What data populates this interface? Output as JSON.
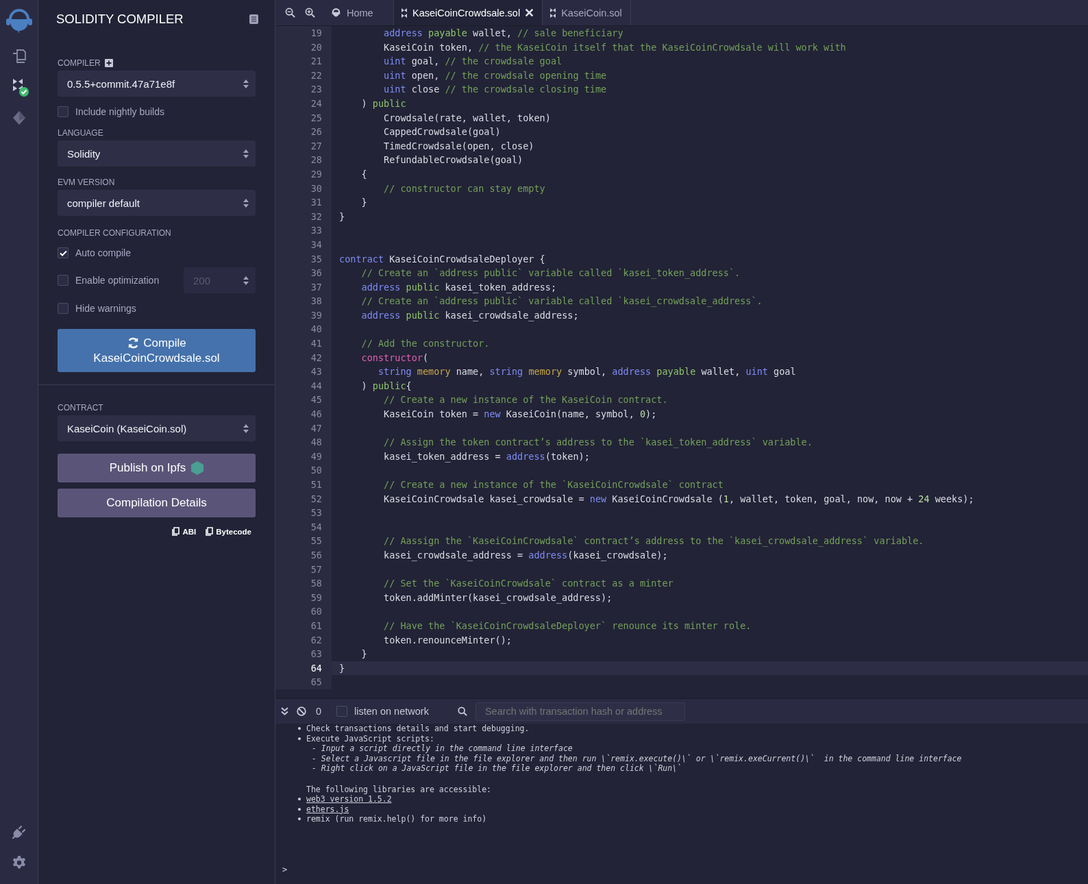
{
  "icon_bar": {
    "items": [
      {
        "kind": "logo"
      },
      {
        "kind": "files"
      },
      {
        "kind": "compiler"
      },
      {
        "kind": "deploy"
      }
    ],
    "bottom_items": [
      {
        "kind": "plugin"
      },
      {
        "kind": "settings"
      }
    ]
  },
  "panel": {
    "title": "SOLIDITY COMPILER",
    "compiler": {
      "label": "COMPILER",
      "value": "0.5.5+commit.47a71e8f"
    },
    "nightly": {
      "label": "Include nightly builds",
      "checked": false
    },
    "language": {
      "label": "LANGUAGE",
      "value": "Solidity"
    },
    "evm": {
      "label": "EVM VERSION",
      "value": "compiler default"
    },
    "config": {
      "label": "COMPILER CONFIGURATION",
      "options": [
        {
          "label": "Auto compile",
          "checked": true
        },
        {
          "label": "Enable optimization",
          "checked": false,
          "runs": "200",
          "disabled": true
        },
        {
          "label": "Hide warnings",
          "checked": false
        }
      ]
    },
    "compile_button": {
      "label": "Compile",
      "file": "KaseiCoinCrowdsale.sol"
    },
    "contract": {
      "label": "CONTRACT",
      "value": "KaseiCoin (KaseiCoin.sol)"
    },
    "buttons": [
      {
        "kind": "ipfs",
        "label": "Publish on Ipfs"
      },
      {
        "kind": "details",
        "label": "Compilation Details"
      }
    ],
    "copy_links": [
      "ABI",
      "Bytecode"
    ]
  },
  "tabs": [
    {
      "kind": "home",
      "label": "Home",
      "selected": false
    },
    {
      "kind": "file",
      "label": "KaseiCoinCrowdsale.sol",
      "selected": true
    },
    {
      "kind": "file",
      "label": "KaseiCoin.sol",
      "selected": false
    }
  ],
  "editor": {
    "lines": [
      {
        "n": "19",
        "current": false,
        "tokens": [
          {
            "kind": "type",
            "text": "        address "
          },
          {
            "kind": "modifier",
            "text": "payable"
          },
          {
            "kind": "plain",
            "text": " wallet, "
          },
          {
            "kind": "comment",
            "text": "// sale beneficiary"
          }
        ]
      },
      {
        "n": "20",
        "current": false,
        "tokens": [
          {
            "kind": "plain",
            "text": "        KaseiCoin token, "
          },
          {
            "kind": "comment",
            "text": "// the KaseiCoin itself that the KaseiCoinCrowdsale will work with"
          }
        ]
      },
      {
        "n": "21",
        "current": false,
        "tokens": [
          {
            "kind": "type",
            "text": "        uint"
          },
          {
            "kind": "plain",
            "text": " goal, "
          },
          {
            "kind": "comment",
            "text": "// the crowdsale goal"
          }
        ]
      },
      {
        "n": "22",
        "current": false,
        "tokens": [
          {
            "kind": "type",
            "text": "        uint"
          },
          {
            "kind": "plain",
            "text": " open, "
          },
          {
            "kind": "comment",
            "text": "// the crowdsale opening time"
          }
        ]
      },
      {
        "n": "23",
        "current": false,
        "tokens": [
          {
            "kind": "type",
            "text": "        uint"
          },
          {
            "kind": "plain",
            "text": " close "
          },
          {
            "kind": "comment",
            "text": "// the crowdsale closing time"
          }
        ]
      },
      {
        "n": "24",
        "current": false,
        "tokens": [
          {
            "kind": "plain",
            "text": "    ) "
          },
          {
            "kind": "modifier",
            "text": "public"
          }
        ]
      },
      {
        "n": "25",
        "current": false,
        "tokens": [
          {
            "kind": "plain",
            "text": "        Crowdsale(rate, wallet, token)"
          }
        ]
      },
      {
        "n": "26",
        "current": false,
        "tokens": [
          {
            "kind": "plain",
            "text": "        CappedCrowdsale(goal)"
          }
        ]
      },
      {
        "n": "27",
        "current": false,
        "tokens": [
          {
            "kind": "plain",
            "text": "        TimedCrowdsale(open, close)"
          }
        ]
      },
      {
        "n": "28",
        "current": false,
        "tokens": [
          {
            "kind": "plain",
            "text": "        RefundableCrowdsale(goal)"
          }
        ]
      },
      {
        "n": "29",
        "current": false,
        "tokens": [
          {
            "kind": "plain",
            "text": "    {"
          }
        ]
      },
      {
        "n": "30",
        "current": false,
        "tokens": [
          {
            "kind": "comment",
            "text": "        // constructor can stay empty"
          }
        ]
      },
      {
        "n": "31",
        "current": false,
        "tokens": [
          {
            "kind": "plain",
            "text": "    }"
          }
        ]
      },
      {
        "n": "32",
        "current": false,
        "tokens": [
          {
            "kind": "plain",
            "text": "}"
          }
        ]
      },
      {
        "n": "33",
        "current": false
      },
      {
        "n": "34",
        "current": false
      },
      {
        "n": "35",
        "current": false,
        "tokens": [
          {
            "kind": "type",
            "text": "contract"
          },
          {
            "kind": "plain",
            "text": " KaseiCoinCrowdsaleDeployer {"
          }
        ]
      },
      {
        "n": "36",
        "current": false,
        "tokens": [
          {
            "kind": "comment",
            "text": "    // Create an `address public` variable called `kasei_token_address`."
          }
        ]
      },
      {
        "n": "37",
        "current": false,
        "tokens": [
          {
            "kind": "type",
            "text": "    address "
          },
          {
            "kind": "modifier",
            "text": "public"
          },
          {
            "kind": "plain",
            "text": " kasei_token_address;"
          }
        ]
      },
      {
        "n": "38",
        "current": false,
        "tokens": [
          {
            "kind": "comment",
            "text": "    // Create an `address public` variable called `kasei_crowdsale_address`."
          }
        ]
      },
      {
        "n": "39",
        "current": false,
        "tokens": [
          {
            "kind": "type",
            "text": "    address "
          },
          {
            "kind": "modifier",
            "text": "public"
          },
          {
            "kind": "plain",
            "text": " kasei_crowdsale_address;"
          }
        ]
      },
      {
        "n": "40",
        "current": false
      },
      {
        "n": "41",
        "current": false,
        "tokens": [
          {
            "kind": "comment",
            "text": "    // Add the constructor."
          }
        ]
      },
      {
        "n": "42",
        "current": false,
        "tokens": [
          {
            "kind": "special",
            "text": "    constructor"
          },
          {
            "kind": "plain",
            "text": "("
          }
        ]
      },
      {
        "n": "43",
        "current": false,
        "tokens": [
          {
            "kind": "type",
            "text": "       string "
          },
          {
            "kind": "storage",
            "text": "memory"
          },
          {
            "kind": "plain",
            "text": " name, "
          },
          {
            "kind": "type",
            "text": "string "
          },
          {
            "kind": "storage",
            "text": "memory"
          },
          {
            "kind": "plain",
            "text": " symbol, "
          },
          {
            "kind": "type",
            "text": "address "
          },
          {
            "kind": "modifier",
            "text": "payable"
          },
          {
            "kind": "plain",
            "text": " wallet, "
          },
          {
            "kind": "type",
            "text": "uint"
          },
          {
            "kind": "plain",
            "text": " goal"
          }
        ]
      },
      {
        "n": "44",
        "current": false,
        "tokens": [
          {
            "kind": "plain",
            "text": "    ) "
          },
          {
            "kind": "modifier",
            "text": "public"
          },
          {
            "kind": "plain",
            "text": "{"
          }
        ]
      },
      {
        "n": "45",
        "current": false,
        "tokens": [
          {
            "kind": "comment",
            "text": "        // Create a new instance of the KaseiCoin contract."
          }
        ]
      },
      {
        "n": "46",
        "current": false,
        "tokens": [
          {
            "kind": "plain",
            "text": "        KaseiCoin token = "
          },
          {
            "kind": "type",
            "text": "new"
          },
          {
            "kind": "plain",
            "text": " KaseiCoin(name, symbol, "
          },
          {
            "kind": "number",
            "text": "0"
          },
          {
            "kind": "plain",
            "text": ");"
          }
        ]
      },
      {
        "n": "47",
        "current": false
      },
      {
        "n": "48",
        "current": false,
        "tokens": [
          {
            "kind": "comment",
            "text": "        // Assign the token contract’s address to the `kasei_token_address` variable."
          }
        ]
      },
      {
        "n": "49",
        "current": false,
        "tokens": [
          {
            "kind": "plain",
            "text": "        kasei_token_address = "
          },
          {
            "kind": "type",
            "text": "address"
          },
          {
            "kind": "plain",
            "text": "(token);"
          }
        ]
      },
      {
        "n": "50",
        "current": false
      },
      {
        "n": "51",
        "current": false,
        "tokens": [
          {
            "kind": "comment",
            "text": "        // Create a new instance of the `KaseiCoinCrowdsale` contract"
          }
        ]
      },
      {
        "n": "52",
        "current": false,
        "tokens": [
          {
            "kind": "plain",
            "text": "        KaseiCoinCrowdsale kasei_crowdsale = "
          },
          {
            "kind": "type",
            "text": "new"
          },
          {
            "kind": "plain",
            "text": " KaseiCoinCrowdsale ("
          },
          {
            "kind": "number",
            "text": "1"
          },
          {
            "kind": "plain",
            "text": ", wallet, token, goal, now, now + "
          },
          {
            "kind": "number",
            "text": "24"
          },
          {
            "kind": "plain",
            "text": " weeks);"
          }
        ]
      },
      {
        "n": "53",
        "current": false
      },
      {
        "n": "54",
        "current": false
      },
      {
        "n": "55",
        "current": false,
        "tokens": [
          {
            "kind": "comment",
            "text": "        // Aassign the `KaseiCoinCrowdsale` contract’s address to the `kasei_crowdsale_address` variable."
          }
        ]
      },
      {
        "n": "56",
        "current": false,
        "tokens": [
          {
            "kind": "plain",
            "text": "        kasei_crowdsale_address = "
          },
          {
            "kind": "type",
            "text": "address"
          },
          {
            "kind": "plain",
            "text": "(kasei_crowdsale);"
          }
        ]
      },
      {
        "n": "57",
        "current": false
      },
      {
        "n": "58",
        "current": false,
        "tokens": [
          {
            "kind": "comment",
            "text": "        // Set the `KaseiCoinCrowdsale` contract as a minter"
          }
        ]
      },
      {
        "n": "59",
        "current": false,
        "tokens": [
          {
            "kind": "plain",
            "text": "        token.addMinter(kasei_crowdsale_address);"
          }
        ]
      },
      {
        "n": "60",
        "current": false
      },
      {
        "n": "61",
        "current": false,
        "tokens": [
          {
            "kind": "comment",
            "text": "        // Have the `KaseiCoinCrowdsaleDeployer` renounce its minter role."
          }
        ]
      },
      {
        "n": "62",
        "current": false,
        "tokens": [
          {
            "kind": "plain",
            "text": "        token.renounceMinter();"
          }
        ]
      },
      {
        "n": "63",
        "current": false,
        "tokens": [
          {
            "kind": "plain",
            "text": "    }"
          }
        ]
      },
      {
        "n": "64",
        "current": true,
        "tokens": [
          {
            "kind": "plain",
            "text": "}"
          }
        ]
      },
      {
        "n": "65",
        "current": false
      }
    ]
  },
  "terminal": {
    "count": "0",
    "listen": {
      "label": "listen on network",
      "checked": false
    },
    "search": {
      "placeholder": "Search with transaction hash or address"
    },
    "lines": [
      {
        "kind": "bullet",
        "text": "Check transactions details and start debugging."
      },
      {
        "kind": "bullet",
        "text": "Execute JavaScript scripts:"
      },
      {
        "kind": "sub",
        "text": "- Input a script directly in the command line interface"
      },
      {
        "kind": "sub",
        "text": "- Select a Javascript file in the file explorer and then run \\`remix.execute()\\` or \\`remix.exeCurrent()\\`  in the command line interface"
      },
      {
        "kind": "sub",
        "text": "- Right click on a JavaScript file in the file explorer and then click \\`Run\\`"
      },
      {
        "kind": "heading",
        "text": "The following libraries are accessible:"
      },
      {
        "kind": "link",
        "text": "web3 version 1.5.2"
      },
      {
        "kind": "link",
        "text": "ethers.js"
      },
      {
        "kind": "bullet",
        "text": "remix (run remix.help() for more info)"
      }
    ],
    "prompt": ">"
  }
}
